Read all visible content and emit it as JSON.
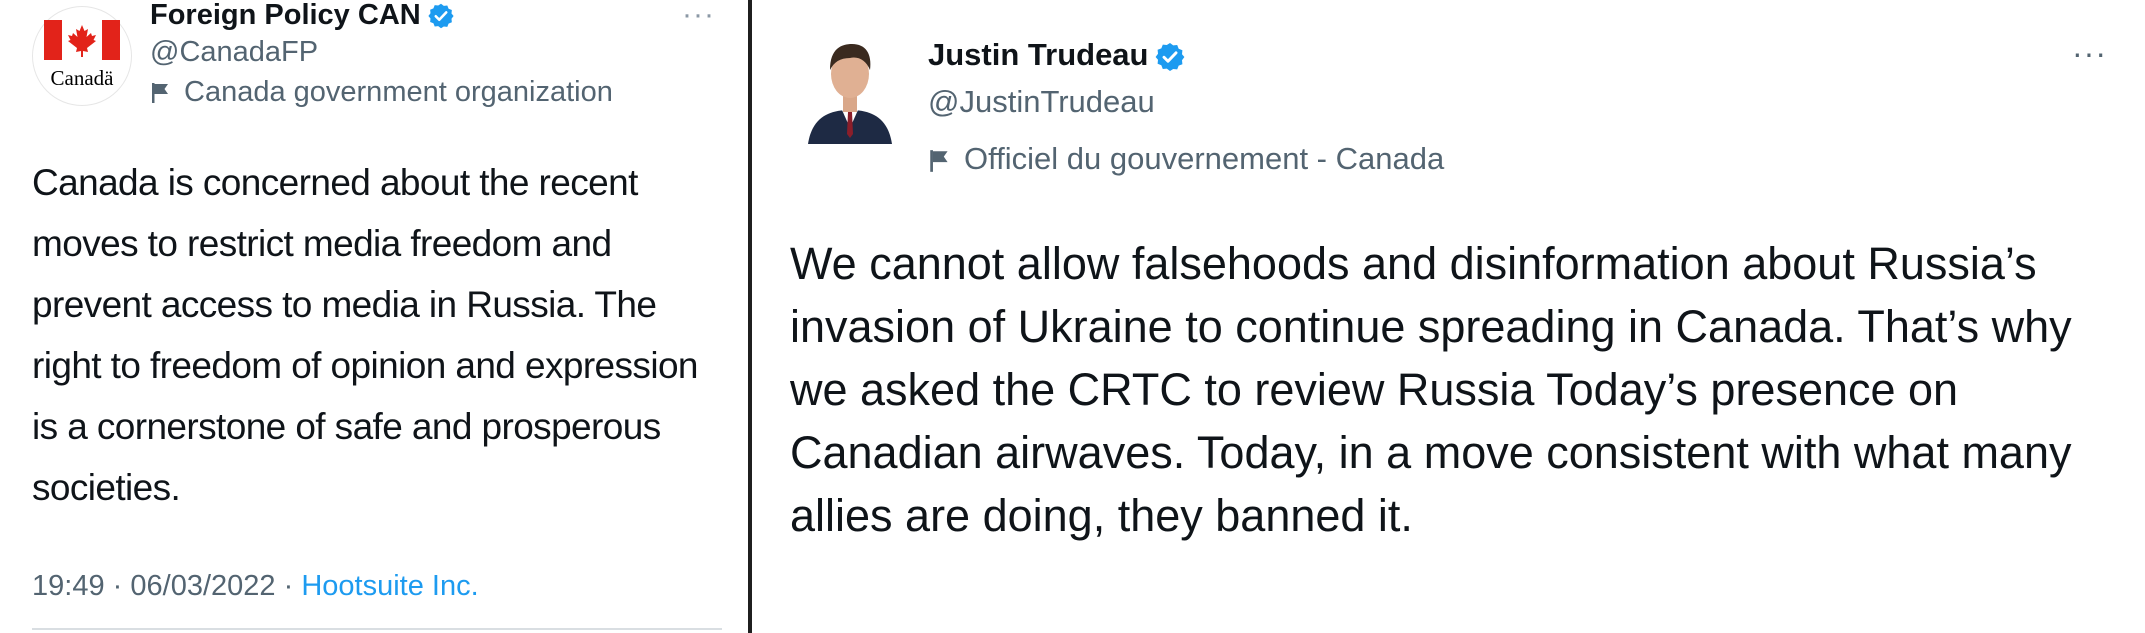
{
  "left_tweet": {
    "account_name": "Foreign Policy CAN",
    "handle": "@CanadaFP",
    "label": "Canada government organization",
    "avatar_text": "Canadä",
    "body": "Canada is concerned about the recent moves to restrict media freedom and prevent access to media in Russia. The right to freedom of opinion and expression is a cornerstone of safe and prosperous societies.",
    "time": "19:49",
    "separator": "·",
    "date": "06/03/2022",
    "source": "Hootsuite Inc.",
    "more_label": "···"
  },
  "right_tweet": {
    "account_name": "Justin Trudeau",
    "handle": "@JustinTrudeau",
    "label": "Officiel du gouvernement - Canada",
    "body": "We cannot allow falsehoods and disinformation about Russia’s invasion of Ukraine to continue spreading in Canada. That’s why we asked the CRTC to review Russia Today’s presence on Canadian airwaves. Today, in a move consistent with what many allies are doing, they banned it.",
    "more_label": "···"
  },
  "colors": {
    "verified_blue": "#1d9bf0",
    "secondary_text": "#536471",
    "canada_red": "#e2231a"
  },
  "icons": [
    "verified-badge-icon",
    "government-flag-icon",
    "more-options-icon",
    "canada-flag-logo",
    "profile-photo"
  ]
}
